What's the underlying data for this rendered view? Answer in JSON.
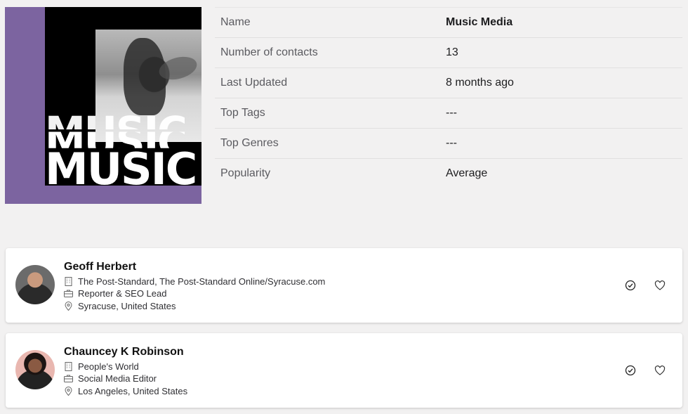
{
  "cover": {
    "word": "MUSIC"
  },
  "info": {
    "rows": [
      {
        "label": "Name",
        "value": "Music Media"
      },
      {
        "label": "Number of contacts",
        "value": "13"
      },
      {
        "label": "Last Updated",
        "value": "8 months ago"
      },
      {
        "label": "Top Tags",
        "value": "---"
      },
      {
        "label": "Top Genres",
        "value": "---"
      },
      {
        "label": "Popularity",
        "value": "Average"
      }
    ]
  },
  "contacts": [
    {
      "name": "Geoff Herbert",
      "outlet": "The Post-Standard, The Post-Standard Online/Syracuse.com",
      "role": "Reporter & SEO Lead",
      "location": "Syracuse, United States"
    },
    {
      "name": "Chauncey K Robinson",
      "outlet": "People's World",
      "role": "Social Media Editor",
      "location": "Los Angeles, United States"
    }
  ],
  "icons": {
    "outlet": "building-icon",
    "role": "briefcase-icon",
    "location": "map-pin-icon",
    "verify": "check-circle-icon",
    "favorite": "heart-icon"
  },
  "colors": {
    "cover_purple": "#7c64a0",
    "background": "#f2f1f1",
    "card": "#ffffff"
  }
}
